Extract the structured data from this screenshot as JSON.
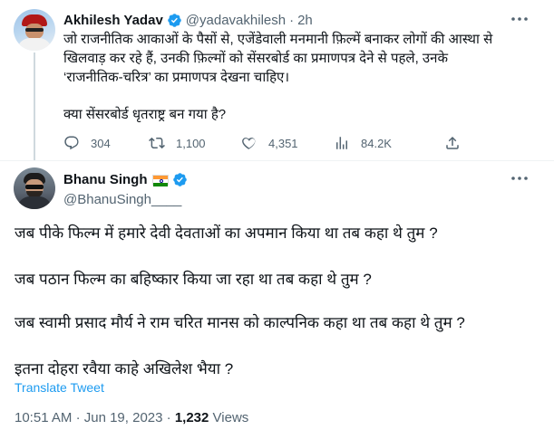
{
  "parent_tweet": {
    "display_name": "Akhilesh Yadav",
    "handle": "@yadavakhilesh",
    "separator": "·",
    "time": "2h",
    "text_lines": [
      "जो राजनीतिक आकाओं के पैसों से, एजेंडेवाली मनमानी फ़िल्में बनाकर लोगों की आस्था से",
      "खिलवाड़ कर रहे हैं, उनकी फ़िल्मों को सेंसरबोर्ड  का प्रमाणपत्र देने से पहले, उनके",
      "‘राजनीतिक-चरित्र’ का प्रमाणपत्र देखना चाहिए।"
    ],
    "question": "क्या सेंसरबोर्ड धृतराष्ट्र बन गया है?",
    "replies": "304",
    "retweets": "1,100",
    "likes": "4,351",
    "views": "84.2K"
  },
  "reply_tweet": {
    "display_name": "Bhanu Singh",
    "handle": "@BhanuSingh____",
    "lines": [
      "जब पीके फिल्म में हमारे देवी देवताओं का अपमान किया था तब कहा थे तुम ?",
      "जब पठान फिल्म का बहिष्कार किया जा रहा था तब कहा थे तुम ?",
      "जब स्वामी प्रसाद मौर्य ने राम चरित मानस को काल्पनिक कहा था तब कहा थे तुम ?",
      "इतना दोहरा रवैया काहे अखिलेश भैया ?"
    ],
    "translate_label": "Translate Tweet",
    "time": "10:51 AM",
    "date": "Jun 19, 2023",
    "separator": "·",
    "views_count": "1,232",
    "views_label": "Views"
  },
  "icons": {
    "verified": "verified-badge-icon",
    "more": "more-options-icon",
    "reply": "reply-icon",
    "retweet": "retweet-icon",
    "like": "heart-icon",
    "views": "views-chart-icon",
    "share": "share-icon",
    "flag": "india-flag-icon"
  },
  "colors": {
    "accent": "#1d9bf0",
    "text": "#0f1419",
    "secondary": "#536471",
    "divider": "#eff3f4",
    "thread_line": "#cfd9de"
  }
}
